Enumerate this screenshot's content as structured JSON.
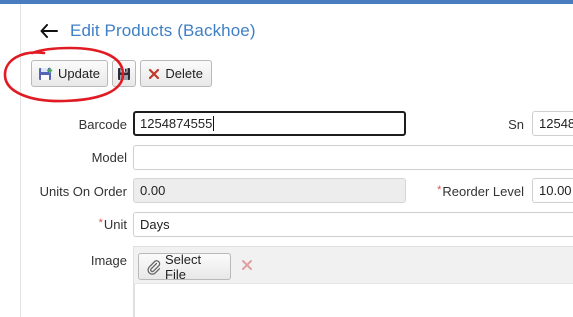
{
  "header": {
    "title": "Edit Products (Backhoe)"
  },
  "toolbar": {
    "update_label": "Update",
    "delete_label": "Delete"
  },
  "form": {
    "barcode": {
      "label": "Barcode",
      "value": "1254874555"
    },
    "sn": {
      "label": "Sn",
      "value": "12548"
    },
    "model": {
      "label": "Model",
      "value": ""
    },
    "units_on_order": {
      "label": "Units On Order",
      "value": "0.00"
    },
    "reorder_level": {
      "label": "Reorder Level",
      "value": "10.00",
      "required_mark": "*"
    },
    "unit": {
      "label": "Unit",
      "value": "Days",
      "required_mark": "*"
    },
    "image": {
      "label": "Image",
      "select_label": "Select File"
    }
  },
  "icons": {
    "back": "arrow-left-icon",
    "update": "disk-upload-icon",
    "save": "floppy-disk-icon",
    "delete": "x-icon",
    "attach": "paperclip-icon",
    "clear": "x-icon"
  },
  "colors": {
    "accent": "#3f7fc5",
    "top_bar": "#4a7cc0",
    "required": "#d9534f",
    "delete": "#c0392b",
    "annotation": "#e01b24"
  }
}
